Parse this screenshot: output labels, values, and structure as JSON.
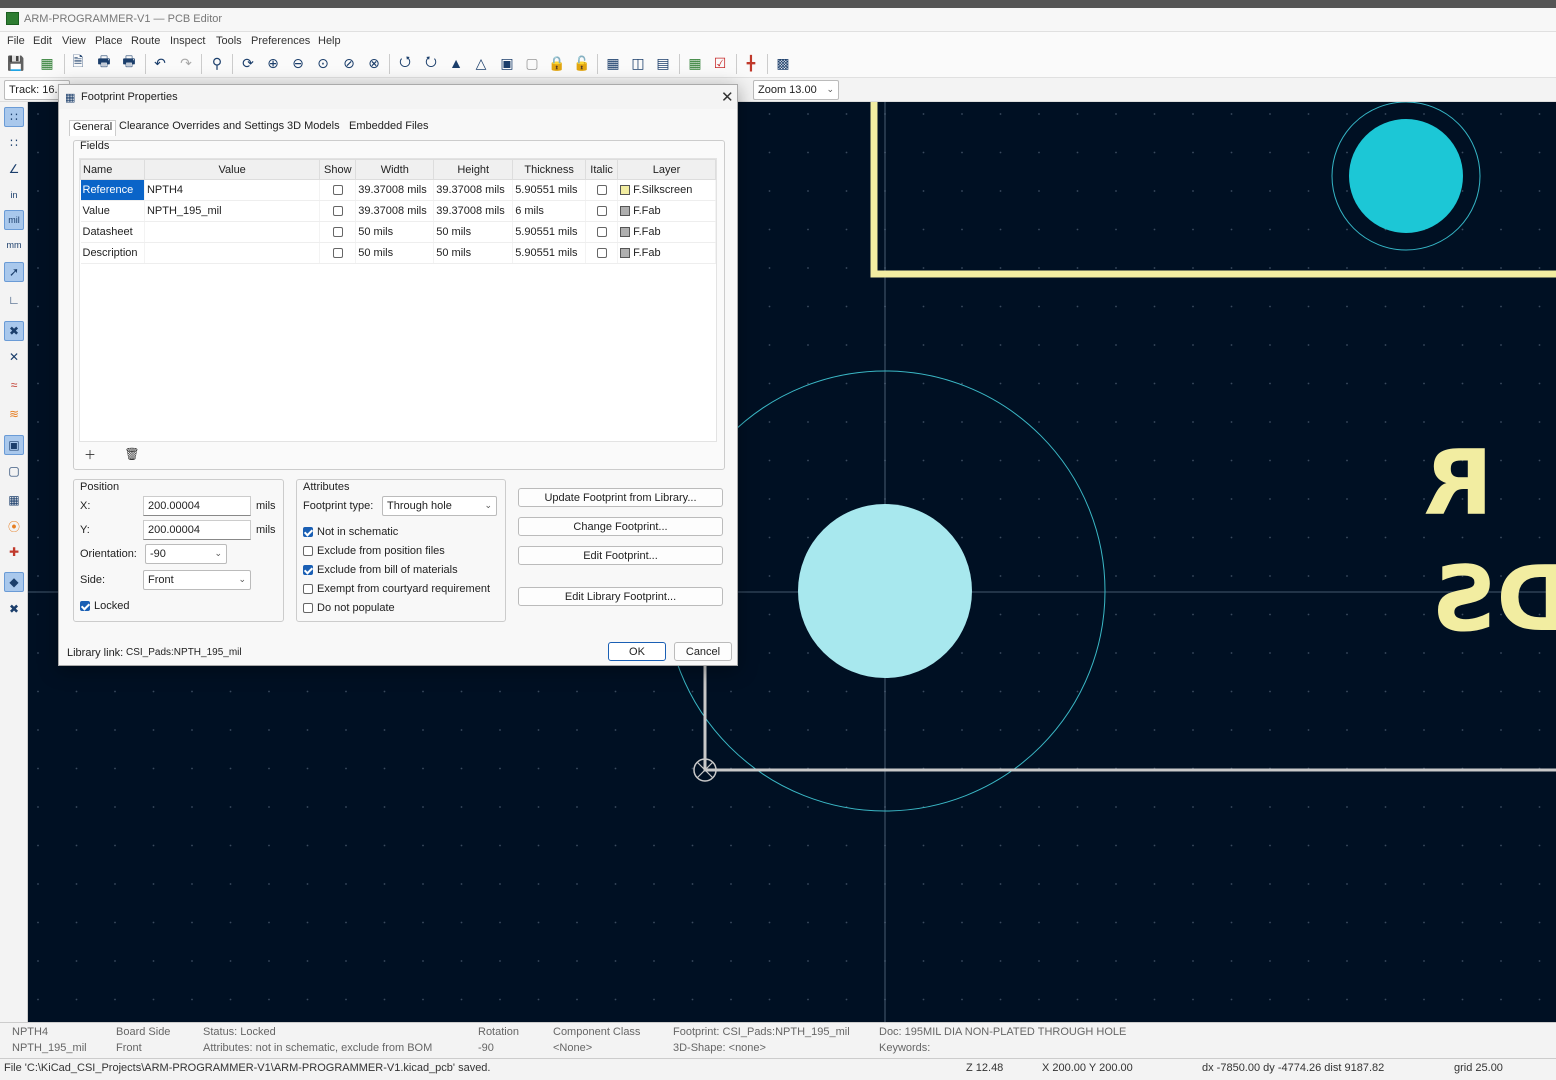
{
  "window": {
    "title": "ARM-PROGRAMMER-V1 — PCB Editor"
  },
  "menu": [
    "File",
    "Edit",
    "View",
    "Place",
    "Route",
    "Inspect",
    "Tools",
    "Preferences",
    "Help"
  ],
  "subbar": {
    "track": "Track: 16.0",
    "zoom": "Zoom 13.00"
  },
  "dialog": {
    "title": "Footprint Properties",
    "tabs": [
      "General",
      "Clearance Overrides and Settings",
      "3D Models",
      "Embedded Files"
    ],
    "fields_label": "Fields",
    "columns": [
      "Name",
      "Value",
      "Show",
      "Width",
      "Height",
      "Thickness",
      "Italic",
      "Layer"
    ],
    "rows": [
      {
        "name": "Reference",
        "value": "NPTH4",
        "show": false,
        "width": "39.37008 mils",
        "height": "39.37008 mils",
        "thickness": "5.90551 mils",
        "italic": false,
        "layer": "F.Silkscreen",
        "layer_color": "#f2eda1"
      },
      {
        "name": "Value",
        "value": "NPTH_195_mil",
        "show": false,
        "width": "39.37008 mils",
        "height": "39.37008 mils",
        "thickness": "6 mils",
        "italic": false,
        "layer": "F.Fab",
        "layer_color": "#afafaf"
      },
      {
        "name": "Datasheet",
        "value": "",
        "show": false,
        "width": "50 mils",
        "height": "50 mils",
        "thickness": "5.90551 mils",
        "italic": false,
        "layer": "F.Fab",
        "layer_color": "#afafaf"
      },
      {
        "name": "Description",
        "value": "",
        "show": false,
        "width": "50 mils",
        "height": "50 mils",
        "thickness": "5.90551 mils",
        "italic": false,
        "layer": "F.Fab",
        "layer_color": "#afafaf"
      }
    ],
    "position": {
      "label": "Position",
      "x_label": "X:",
      "x_value": "200.00004",
      "x_unit": "mils",
      "y_label": "Y:",
      "y_value": "200.00004",
      "y_unit": "mils",
      "orientation_label": "Orientation:",
      "orientation_value": "-90",
      "side_label": "Side:",
      "side_value": "Front",
      "locked_label": "Locked"
    },
    "attributes": {
      "label": "Attributes",
      "fp_type_label": "Footprint type:",
      "fp_type_value": "Through hole",
      "not_in_schematic": "Not in schematic",
      "exclude_position": "Exclude from position files",
      "exclude_bom": "Exclude from bill of materials",
      "exempt_courtyard": "Exempt from courtyard requirement",
      "do_not_populate": "Do not populate"
    },
    "buttons": {
      "update": "Update Footprint from Library...",
      "change": "Change Footprint...",
      "edit": "Edit Footprint...",
      "edit_lib": "Edit Library Footprint...",
      "ok": "OK",
      "cancel": "Cancel"
    },
    "library_link_label": "Library link:",
    "library_link_value": "CSI_Pads:NPTH_195_mil"
  },
  "canvas": {
    "silk_text_1": "R",
    "silk_text_2": "DS"
  },
  "status": {
    "ref": "NPTH4",
    "val": "NPTH_195_mil",
    "board_side_label": "Board Side",
    "board_side": "Front",
    "status": "Status: Locked",
    "attributes": "Attributes: not in schematic, exclude from BOM",
    "rotation_label": "Rotation",
    "rotation": "-90",
    "component_class_label": "Component Class",
    "component_class": "<None>",
    "footprint": "Footprint: CSI_Pads:NPTH_195_mil",
    "shape3d": "3D-Shape: <none>",
    "doc": "Doc: 195MIL DIA NON-PLATED THROUGH HOLE",
    "keywords": "Keywords:"
  },
  "bottom": {
    "file": "File 'C:\\KiCad_CSI_Projects\\ARM-PROGRAMMER-V1\\ARM-PROGRAMMER-V1.kicad_pcb' saved.",
    "z": "Z 12.48",
    "xy": "X 200.00  Y 200.00",
    "delta": "dx -7850.00  dy -4774.26  dist 9187.82",
    "grid": "grid 25.00"
  }
}
